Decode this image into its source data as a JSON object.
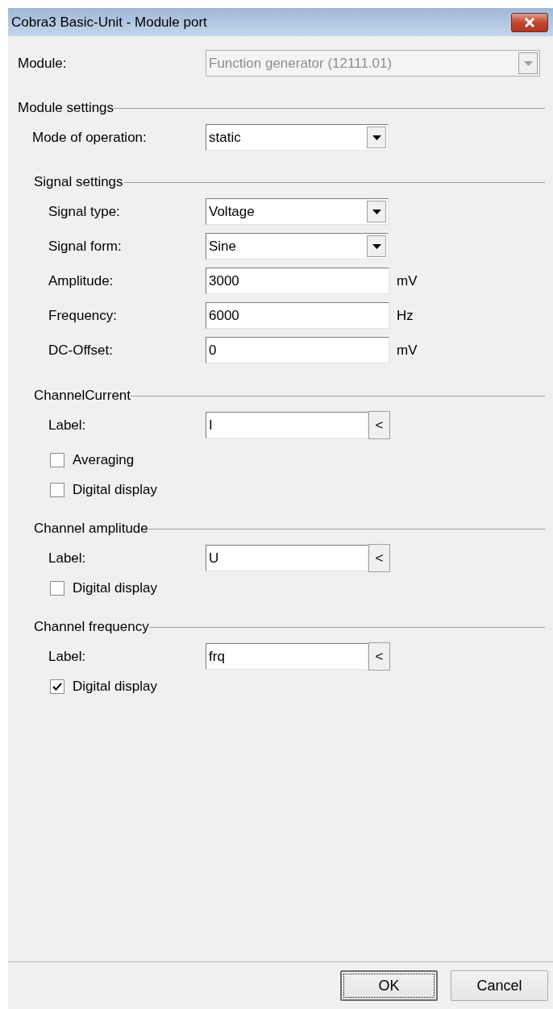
{
  "window": {
    "title": "Cobra3 Basic-Unit - Module port"
  },
  "module": {
    "label": "Module:",
    "value": "Function generator  (12111.01)",
    "disabled": true
  },
  "module_settings": {
    "title": "Module settings",
    "mode": {
      "label": "Mode of operation:",
      "value": "static"
    },
    "signal_settings": {
      "title": "Signal settings",
      "fields": [
        {
          "kind": "select",
          "label": "Signal type:",
          "value": "Voltage"
        },
        {
          "kind": "select",
          "label": "Signal form:",
          "value": "Sine"
        },
        {
          "kind": "input",
          "label": "Amplitude:",
          "value": "3000",
          "unit": "mV"
        },
        {
          "kind": "input",
          "label": "Frequency:",
          "value": "6000",
          "unit": "Hz"
        },
        {
          "kind": "input",
          "label": "DC-Offset:",
          "value": "0",
          "unit": "mV"
        }
      ]
    }
  },
  "channels": [
    {
      "title": "ChannelCurrent",
      "label_field": {
        "label": "Label:",
        "value": "I",
        "button": "<"
      },
      "checkboxes": [
        {
          "label": "Averaging",
          "checked": false
        },
        {
          "label": "Digital display",
          "checked": false
        }
      ]
    },
    {
      "title": "Channel amplitude",
      "label_field": {
        "label": "Label:",
        "value": "U",
        "button": "<"
      },
      "checkboxes": [
        {
          "label": "Digital display",
          "checked": false
        }
      ]
    },
    {
      "title": "Channel frequency",
      "label_field": {
        "label": "Label:",
        "value": "frq",
        "button": "<"
      },
      "checkboxes": [
        {
          "label": "Digital display",
          "checked": true
        }
      ]
    }
  ],
  "buttons": [
    {
      "label": "OK",
      "focused": true
    },
    {
      "label": "Cancel",
      "focused": false
    }
  ]
}
